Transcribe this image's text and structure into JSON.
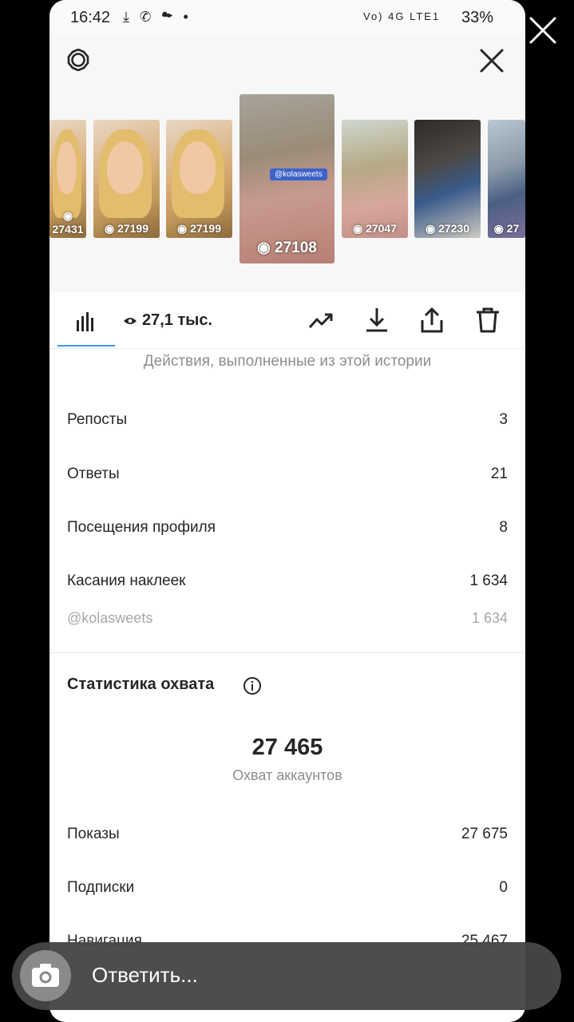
{
  "status_bar": {
    "time": "16:42",
    "left_icons": "⤓ ✆ ☁ •",
    "network": "Vo) 4G LTE1",
    "battery": "33%"
  },
  "thumbnails": [
    {
      "count": "27431",
      "kind": "woman"
    },
    {
      "count": "27199",
      "kind": "woman"
    },
    {
      "count": "27199",
      "kind": "woman"
    },
    {
      "count": "27108",
      "kind": "jewel",
      "tag": "@kolasweets"
    },
    {
      "count": "27047",
      "kind": "jewel2"
    },
    {
      "count": "27230",
      "kind": "man"
    },
    {
      "count": "27",
      "kind": "man2"
    }
  ],
  "toolbar": {
    "views_label": "27,1 тыс."
  },
  "actions_caption": "Действия, выполненные из этой истории",
  "metrics": [
    {
      "label": "Репосты",
      "value": "3"
    },
    {
      "label": "Ответы",
      "value": "21"
    },
    {
      "label": "Посещения профиля",
      "value": "8"
    },
    {
      "label": "Касания наклеек",
      "value": "1 634"
    },
    {
      "label": "@kolasweets",
      "value": "1 634"
    }
  ],
  "reach": {
    "title": "Статистика охвата",
    "number": "27 465",
    "label": "Охват аккаунтов"
  },
  "reach_metrics": [
    {
      "label": "Показы",
      "value": "27 675"
    },
    {
      "label": "Подписки",
      "value": "0"
    },
    {
      "label": "Навигация",
      "value": "25 467"
    }
  ],
  "reply": {
    "placeholder": "Ответить..."
  },
  "colors": {
    "accent_blue": "#3897f0",
    "text": "#262626",
    "muted": "#8e8e8e"
  }
}
